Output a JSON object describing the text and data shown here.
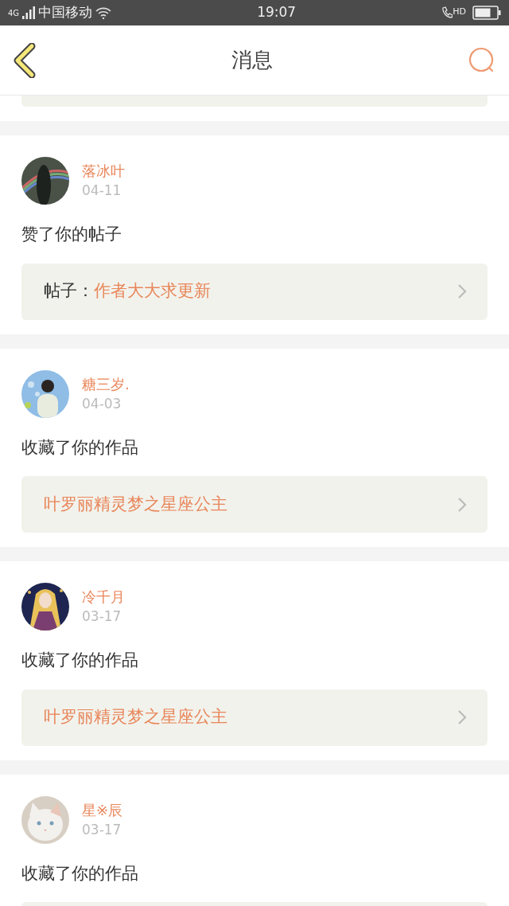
{
  "status_bar": {
    "network": "4G",
    "carrier": "中国移动",
    "time": "19:07",
    "call_badge": "HD"
  },
  "header": {
    "title": "消息"
  },
  "messages": [
    {
      "name": "落冰叶",
      "date": "04-11",
      "action": "赞了你的帖子",
      "link_label": "帖子：",
      "link_title": "作者大大求更新"
    },
    {
      "name": "糖三岁.",
      "date": "04-03",
      "action": "收藏了你的作品",
      "link_title": "叶罗丽精灵梦之星座公主"
    },
    {
      "name": "冷千月",
      "date": "03-17",
      "action": "收藏了你的作品",
      "link_title": "叶罗丽精灵梦之星座公主"
    },
    {
      "name": "星※辰",
      "date": "03-17",
      "action": "收藏了你的作品"
    }
  ]
}
